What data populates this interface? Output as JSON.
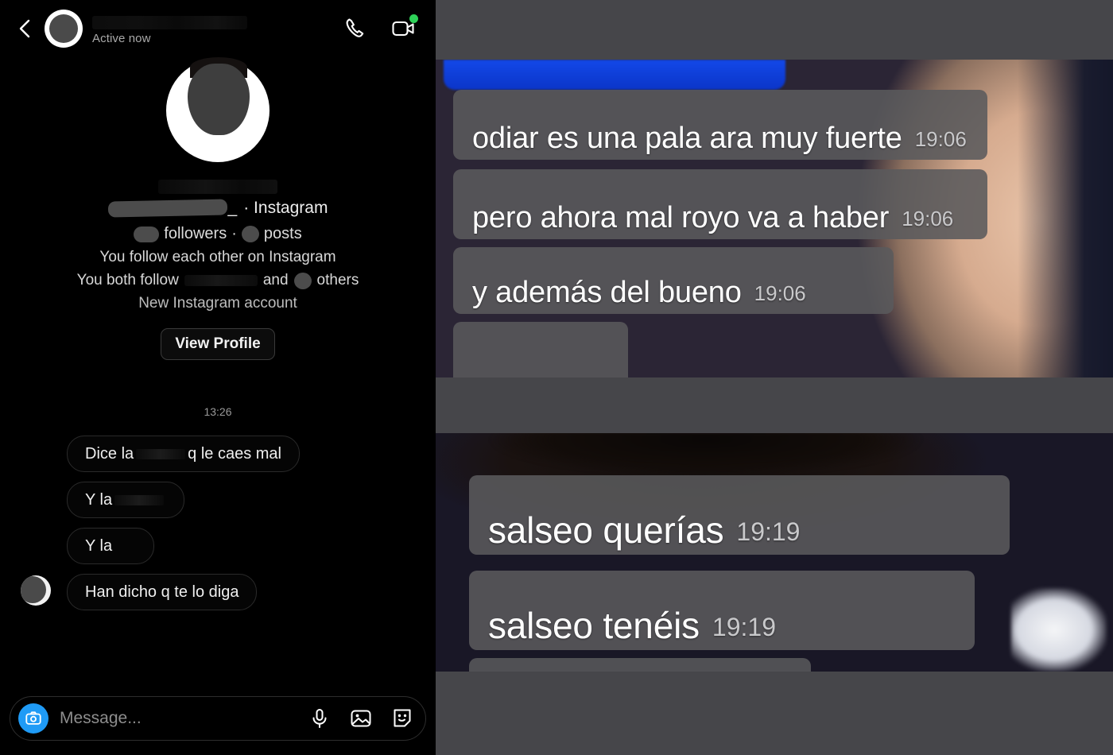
{
  "left_panel": {
    "header": {
      "back_icon": "back-chevron-icon",
      "avatar": "contact-avatar",
      "name_redacted": "",
      "status": "Active now",
      "audio_call_icon": "phone-icon",
      "video_call_icon": "video-camera-icon",
      "video_active_dot": "green-status-dot"
    },
    "profile": {
      "avatar": "profile-avatar",
      "name_redacted": "",
      "handle_suffix": "_",
      "platform": "· Instagram",
      "followers_label": "followers",
      "separator": "·",
      "posts_label": "posts",
      "mutual_follow": "You follow each other on Instagram",
      "both_follow_prefix": "You both follow",
      "both_follow_and": "and",
      "both_follow_others": "others",
      "account_age": "New Instagram account",
      "view_profile_button": "View Profile"
    },
    "conversation": {
      "timestamp_separator": "13:26",
      "messages": [
        {
          "before": "Dice la",
          "after": "q le caes mal",
          "redacted": true
        },
        {
          "before": "Y la",
          "after": "",
          "redacted": true
        },
        {
          "before": "Y la",
          "after": "",
          "redacted": false
        },
        {
          "before": "Han dicho q te lo diga",
          "after": "",
          "redacted": false
        }
      ]
    },
    "composer": {
      "camera_icon": "camera-icon",
      "placeholder": "Message...",
      "value": "",
      "mic_icon": "microphone-icon",
      "gallery_icon": "image-icon",
      "sticker_icon": "sticker-icon"
    }
  },
  "right_panel": {
    "top_screenshot": {
      "messages": [
        {
          "text": "odiar es una pala ara muy fuerte",
          "time": "19:06"
        },
        {
          "text": "pero ahora mal royo va a haber",
          "time": "19:06"
        },
        {
          "text": "y además del bueno",
          "time": "19:06"
        }
      ]
    },
    "bottom_screenshot": {
      "messages": [
        {
          "text": "salseo querías",
          "time": "19:19"
        },
        {
          "text": "salseo tenéis",
          "time": "19:19"
        }
      ]
    }
  },
  "colors": {
    "page_background": "#46464a",
    "left_panel_background": "#000000",
    "accent_blue": "#1f9bf6",
    "online_green": "#2ed158",
    "bubble_grey": "#5a5a5c",
    "timestamp_grey": "#c9c9cb"
  }
}
